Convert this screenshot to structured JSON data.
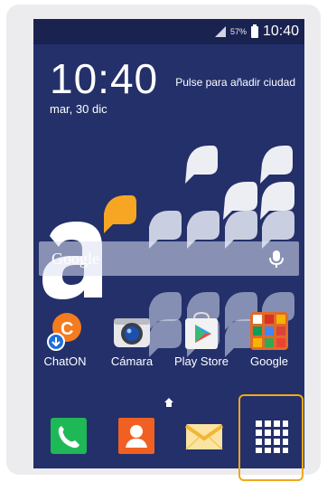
{
  "status_bar": {
    "battery": "57%",
    "time": "10:40"
  },
  "clock_widget": {
    "time": "10:40",
    "date": "mar, 30 dic",
    "weather_hint": "Pulse para añadir ciudad"
  },
  "search": {
    "placeholder": "Google"
  },
  "apps": [
    {
      "label": "ChatON",
      "icon": "chaton-icon"
    },
    {
      "label": "Cámara",
      "icon": "camera-icon"
    },
    {
      "label": "Play Store",
      "icon": "play-store-icon"
    },
    {
      "label": "Google",
      "icon": "google-folder-icon"
    }
  ],
  "dock": [
    {
      "icon": "phone-icon"
    },
    {
      "icon": "contacts-icon"
    },
    {
      "icon": "messages-icon"
    },
    {
      "icon": "apps-grid-icon"
    }
  ],
  "colors": {
    "wallpaper": "#23306a",
    "highlight": "#f0a81a",
    "brand_orange": "#f6a623"
  }
}
